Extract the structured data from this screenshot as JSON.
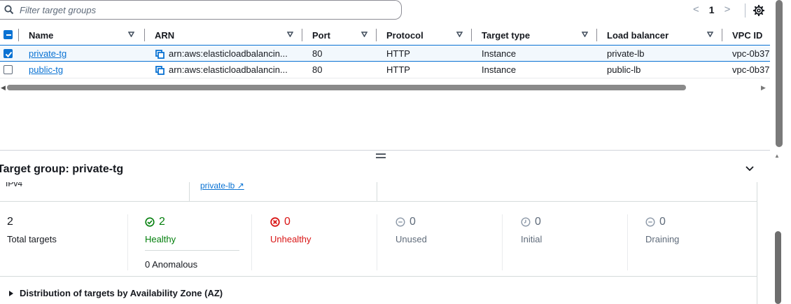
{
  "search": {
    "placeholder": "Filter target groups"
  },
  "pagination": {
    "prev": "<",
    "page": "1",
    "next": ">"
  },
  "table": {
    "columns": [
      "Name",
      "ARN",
      "Port",
      "Protocol",
      "Target type",
      "Load balancer",
      "VPC ID"
    ],
    "rows": [
      {
        "name": "private-tg",
        "arn": "arn:aws:elasticloadbalancin...",
        "port": "80",
        "protocol": "HTTP",
        "target_type": "Instance",
        "load_balancer": "private-lb",
        "vpc_id": "vpc-0b37",
        "selected": true
      },
      {
        "name": "public-tg",
        "arn": "arn:aws:elasticloadbalancin...",
        "port": "80",
        "protocol": "HTTP",
        "target_type": "Instance",
        "load_balancer": "public-lb",
        "vpc_id": "vpc-0b37",
        "selected": false
      }
    ]
  },
  "detail": {
    "title": "Target group: private-tg",
    "ip_type": "IPv4",
    "load_balancer_link": "private-lb",
    "stats": {
      "total": {
        "value": "2",
        "label": "Total targets"
      },
      "healthy": {
        "value": "2",
        "label": "Healthy"
      },
      "unhealthy": {
        "value": "0",
        "label": "Unhealthy"
      },
      "unused": {
        "value": "0",
        "label": "Unused"
      },
      "initial": {
        "value": "0",
        "label": "Initial"
      },
      "draining": {
        "value": "0",
        "label": "Draining"
      }
    },
    "anomalous": "0 Anomalous",
    "distribution_label": "Distribution of targets by Availability Zone (AZ)"
  },
  "colors": {
    "link": "#0972d3",
    "healthy": "#037f0c",
    "unhealthy": "#d91515",
    "muted": "#5f6b7a"
  }
}
